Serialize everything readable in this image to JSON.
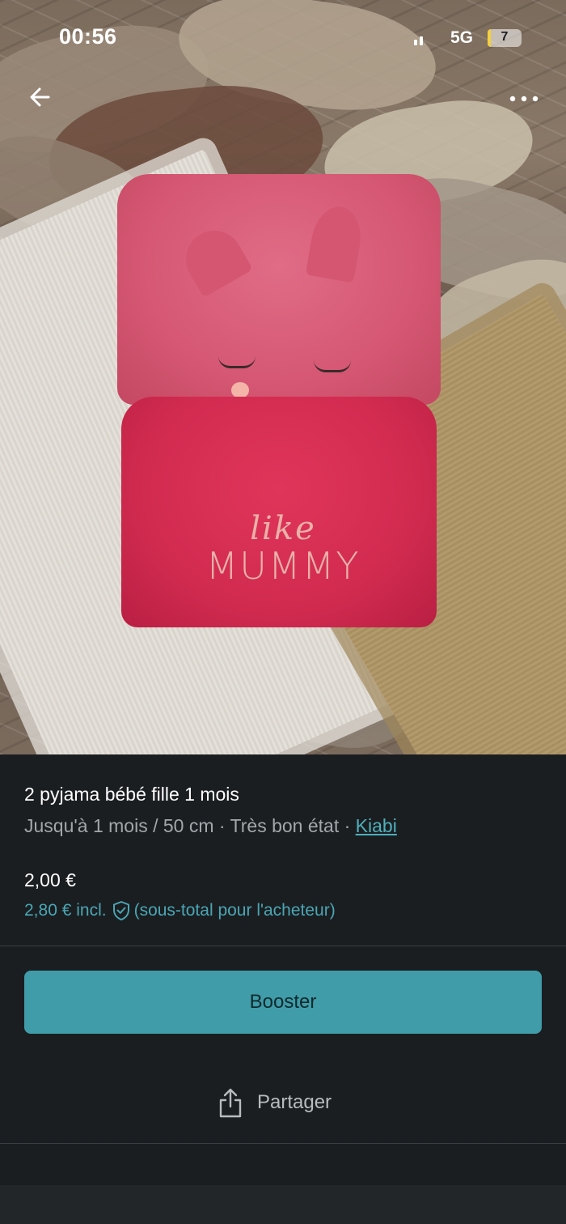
{
  "status_bar": {
    "time": "00:56",
    "network": "5G",
    "battery": "7"
  },
  "photo": {
    "garment_text_line1": "like",
    "garment_text_line2": "MUMMY"
  },
  "listing": {
    "title": "2 pyjama bébé fille 1 mois",
    "size": "Jusqu'à 1 mois / 50 cm",
    "separator": "·",
    "condition": "Très bon état",
    "brand": "Kiabi",
    "price": "2,00 €",
    "price_incl": "2,80 € incl.",
    "price_incl_note": "(sous-total pour l'acheteur)"
  },
  "actions": {
    "booster_label": "Booster",
    "share_label": "Partager"
  },
  "icons": {
    "back": "arrow-left-icon",
    "more": "more-horizontal-icon",
    "shield": "shield-check-icon",
    "share": "share-icon"
  },
  "colors": {
    "accent": "#3f9ca8",
    "link": "#4fb0bd",
    "background": "#1b1e21"
  }
}
